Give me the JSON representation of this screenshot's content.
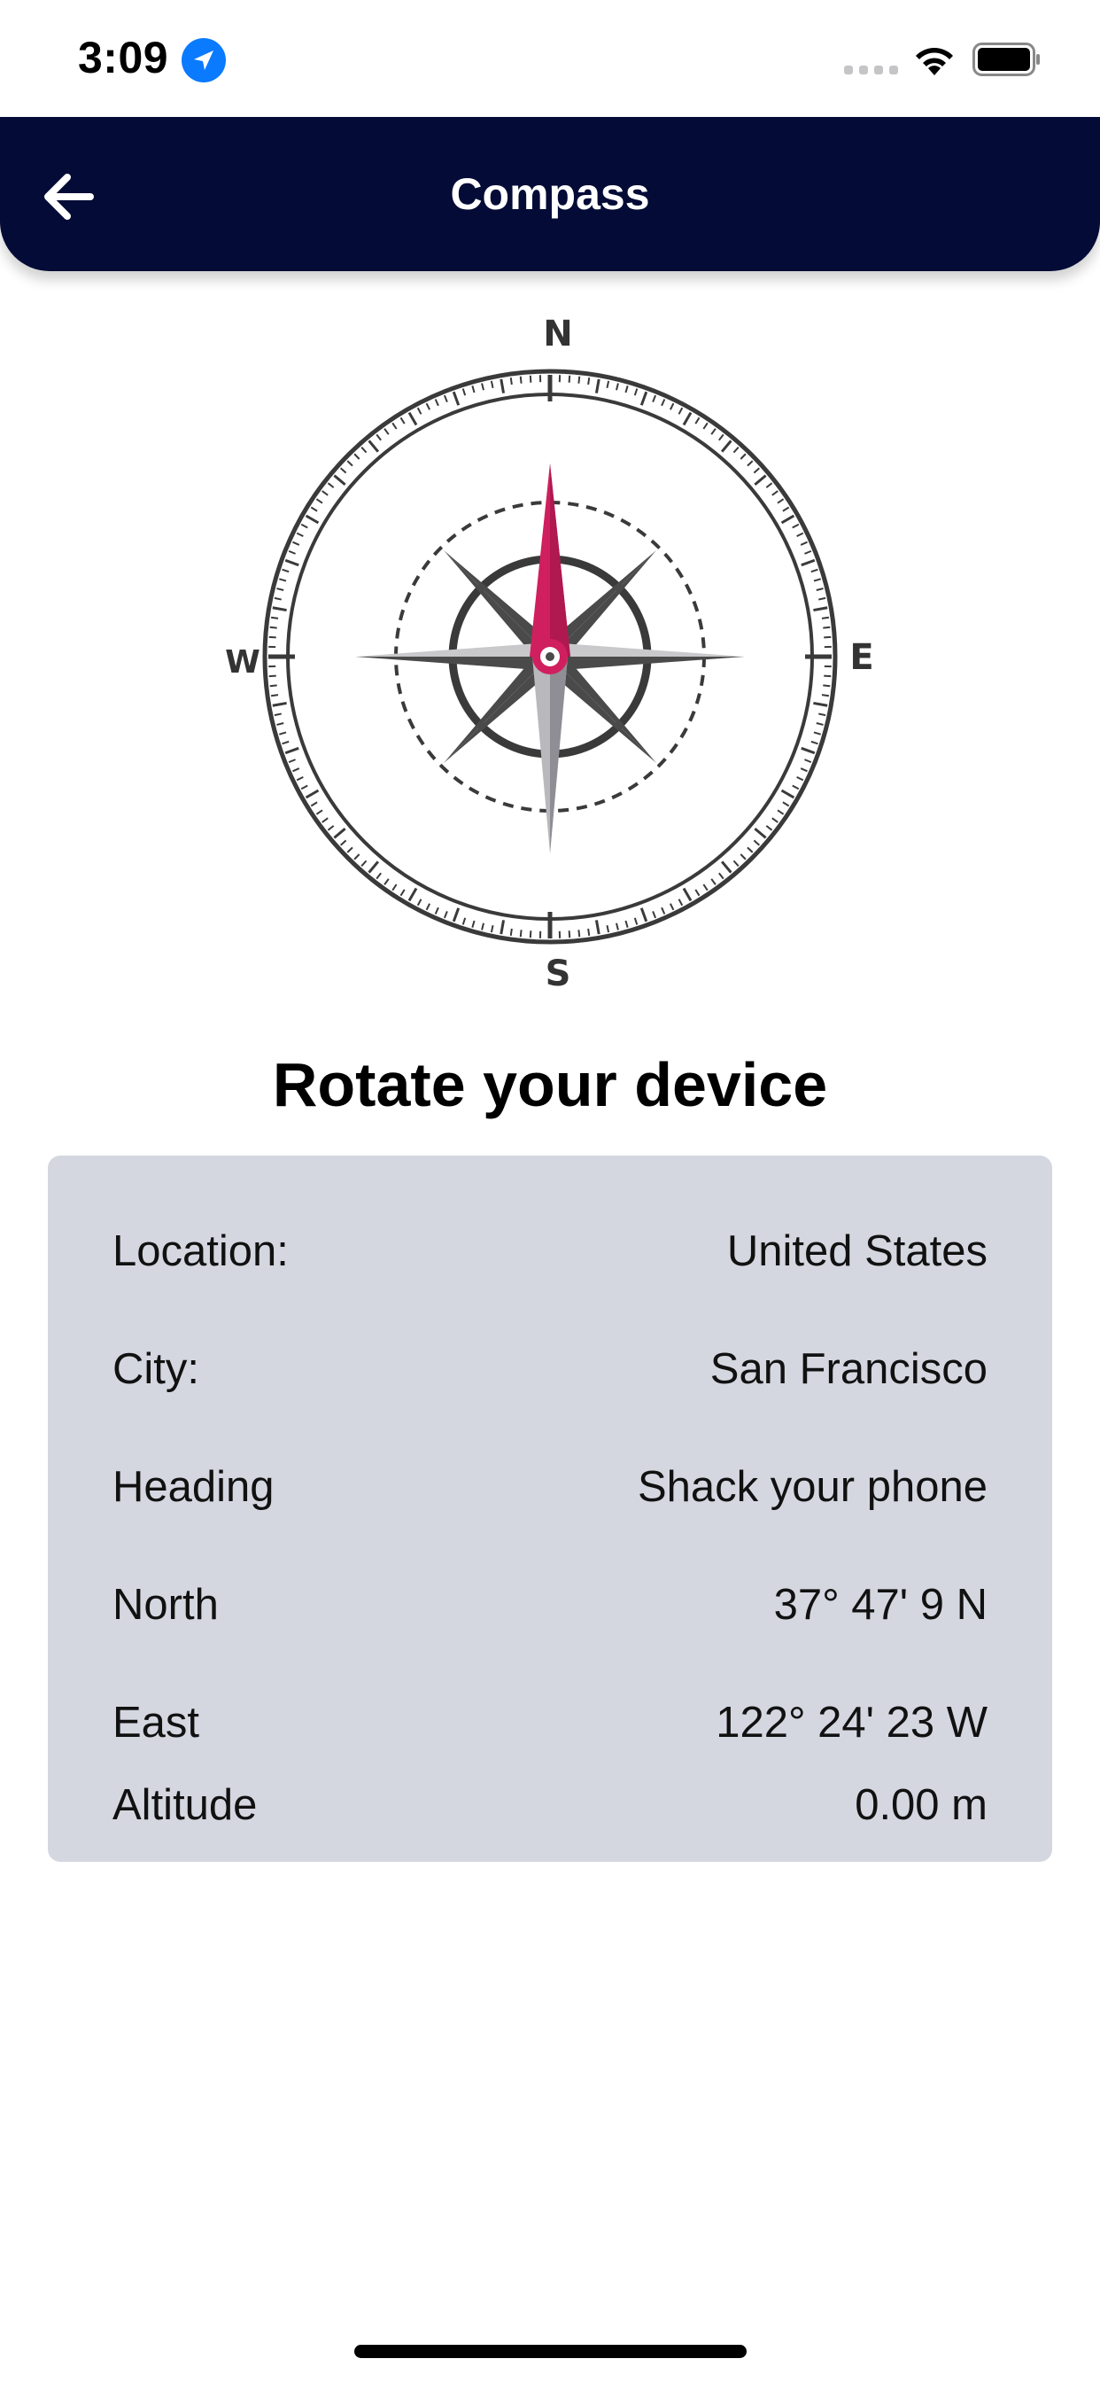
{
  "status_bar": {
    "time": "3:09",
    "location_icon": "location-arrow-icon",
    "signal_icon": "cellular-signal-icon",
    "wifi_icon": "wifi-icon",
    "battery_icon": "battery-icon"
  },
  "header": {
    "title": "Compass",
    "back_icon": "arrow-left-icon",
    "background_color": "#030b36"
  },
  "compass": {
    "north": "N",
    "south": "S",
    "east": "E",
    "west": "W",
    "needle_color": "#d01f5e"
  },
  "instruction": "Rotate your device",
  "info": {
    "rows": [
      {
        "label": "Location:",
        "value": "United States"
      },
      {
        "label": "City:",
        "value": "San Francisco"
      },
      {
        "label": "Heading",
        "value": "Shack your phone"
      },
      {
        "label": "North",
        "value": "37° 47' 9 N"
      },
      {
        "label": "East",
        "value": "122° 24' 23 W"
      },
      {
        "label": "Altitude",
        "value": "0.00 m"
      }
    ],
    "background_color": "#d4d7e0"
  }
}
